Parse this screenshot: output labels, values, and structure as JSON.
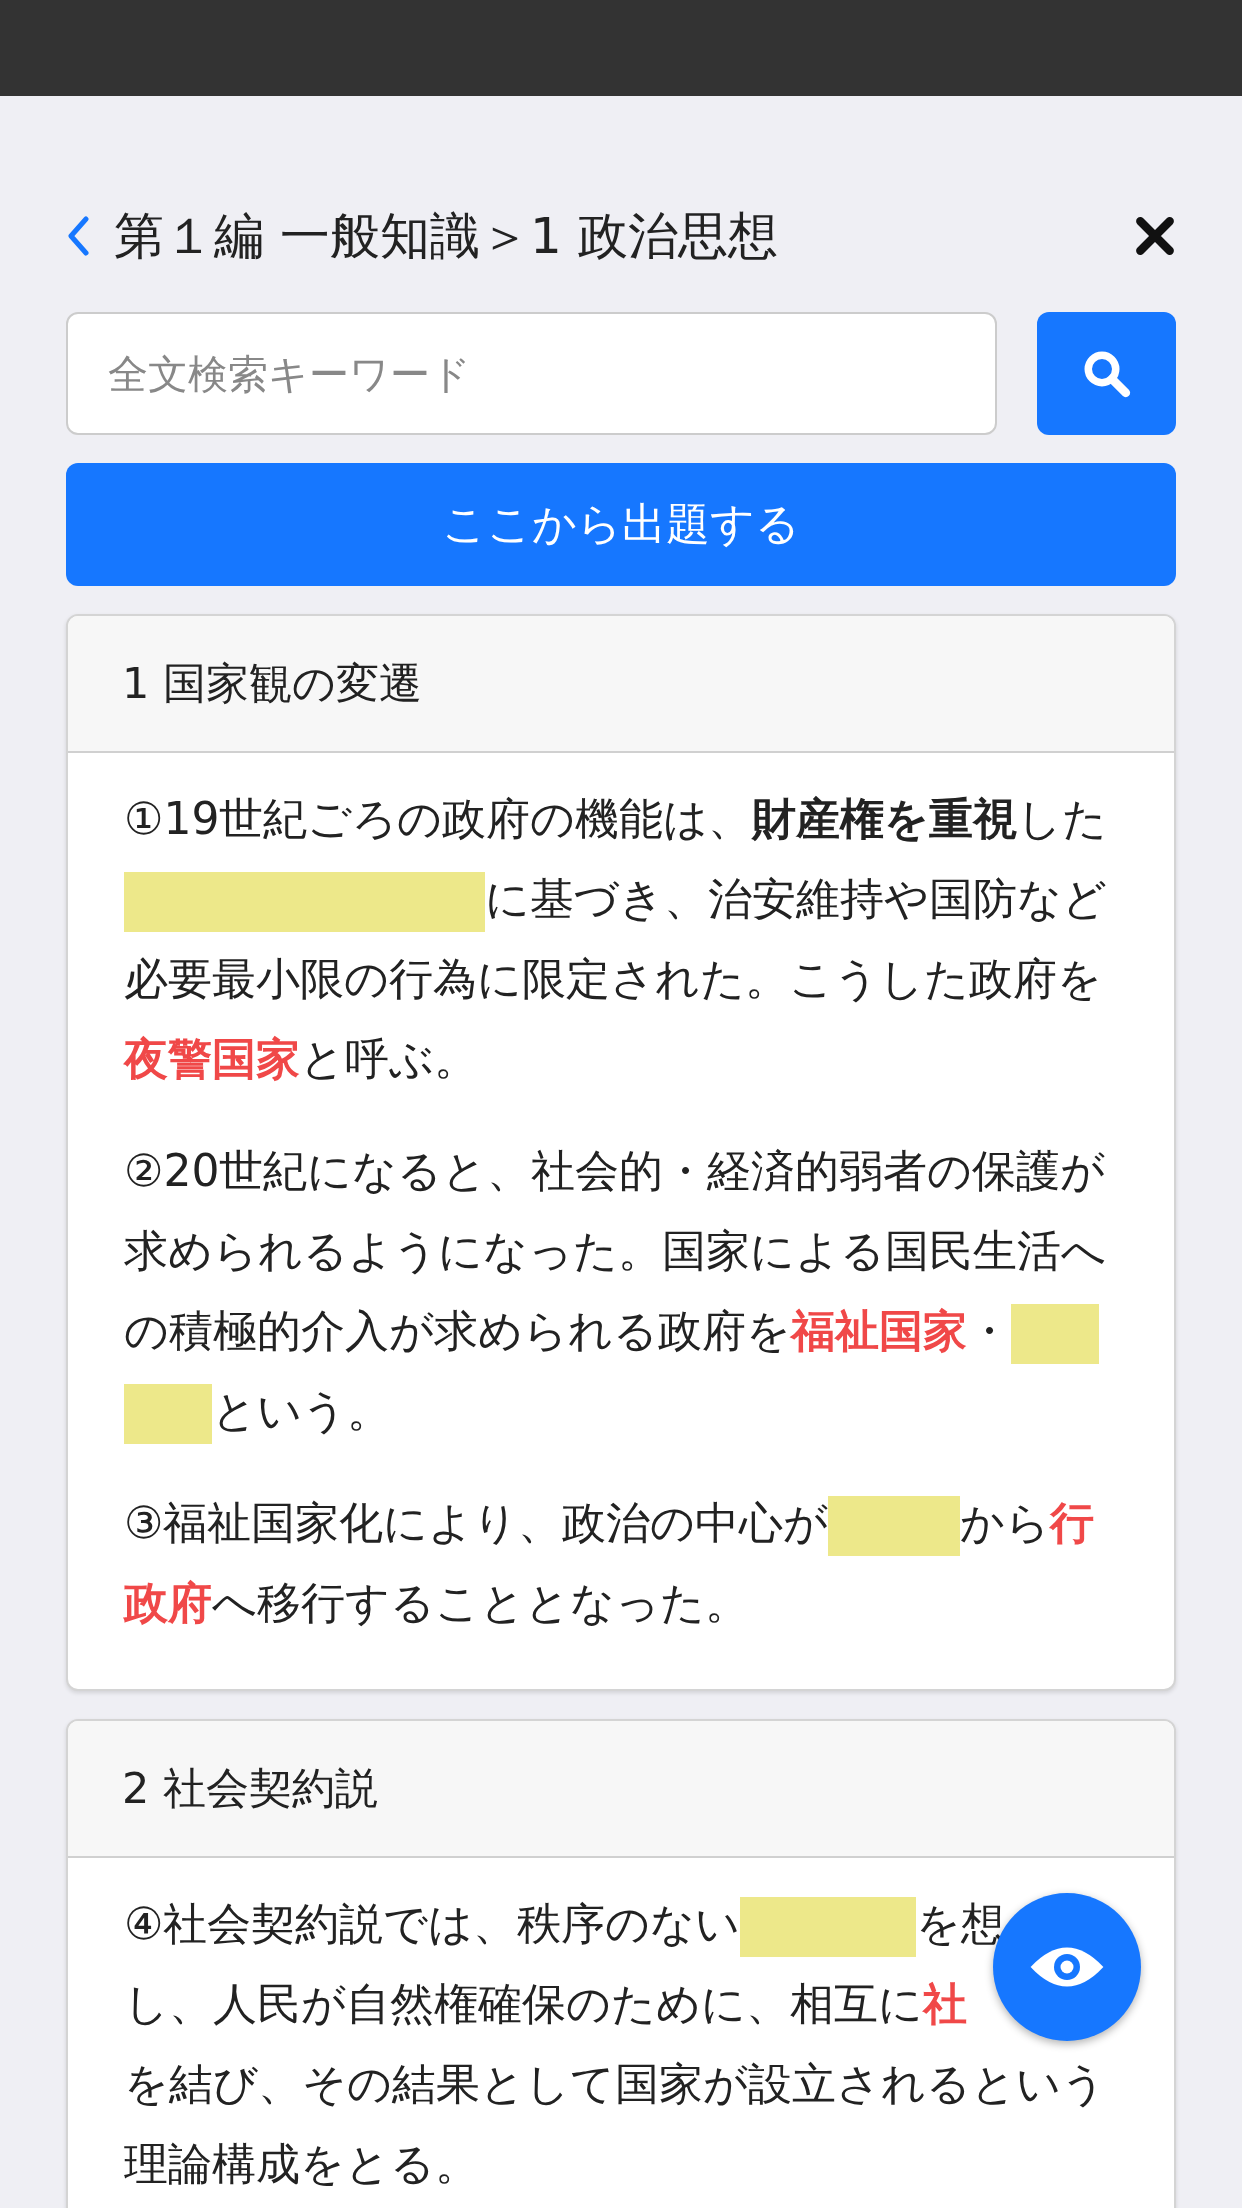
{
  "header": {
    "title": "第１編 一般知識＞1 政治思想"
  },
  "search": {
    "placeholder": "全文検索キーワード"
  },
  "start_button": "ここから出題する",
  "sections": [
    {
      "title": "1 国家観の変遷",
      "paragraphs": [
        {
          "segments": [
            {
              "kind": "text",
              "text": "①19世紀ごろの政府の機能は、"
            },
            {
              "kind": "bold",
              "text": "財産権を重視"
            },
            {
              "kind": "text",
              "text": "した"
            },
            {
              "kind": "wide_blank"
            },
            {
              "kind": "text",
              "text": "に基づき、治安維持や国防など必要最小限の行為に限定された。こうした政府を"
            },
            {
              "kind": "red",
              "text": "夜警国家"
            },
            {
              "kind": "text",
              "text": "と呼ぶ。"
            }
          ]
        },
        {
          "segments": [
            {
              "kind": "text",
              "text": "②20世紀になると、社会的・経済的弱者の保護が求められるようになった。国家による国民生活への積極的介入が求められる政府を"
            },
            {
              "kind": "red",
              "text": "福祉国家"
            },
            {
              "kind": "text",
              "text": "・"
            },
            {
              "kind": "split_blank"
            },
            {
              "kind": "text",
              "text": "という。"
            }
          ]
        },
        {
          "segments": [
            {
              "kind": "text",
              "text": "③福祉国家化により、政治の中心が"
            },
            {
              "kind": "medium_blank"
            },
            {
              "kind": "text",
              "text": "から"
            },
            {
              "kind": "red",
              "text": "行政府"
            },
            {
              "kind": "text",
              "text": "へ移行することとなった。"
            }
          ]
        }
      ]
    },
    {
      "title": "2 社会契約説",
      "paragraphs": [
        {
          "segments": [
            {
              "kind": "text",
              "text": "④社会契約説では、秩序のない"
            },
            {
              "kind": "long_blank"
            },
            {
              "kind": "text",
              "text": "を想"
            },
            {
              "kind": "covered"
            },
            {
              "kind": "text",
              "text": "し、人民が自然権確保のために、相互に"
            },
            {
              "kind": "red",
              "text": "社"
            },
            {
              "kind": "covered"
            },
            {
              "kind": "text",
              "text": "を結び、その結果として国家が設立されるという理論構成をとる。"
            }
          ]
        }
      ]
    }
  ]
}
